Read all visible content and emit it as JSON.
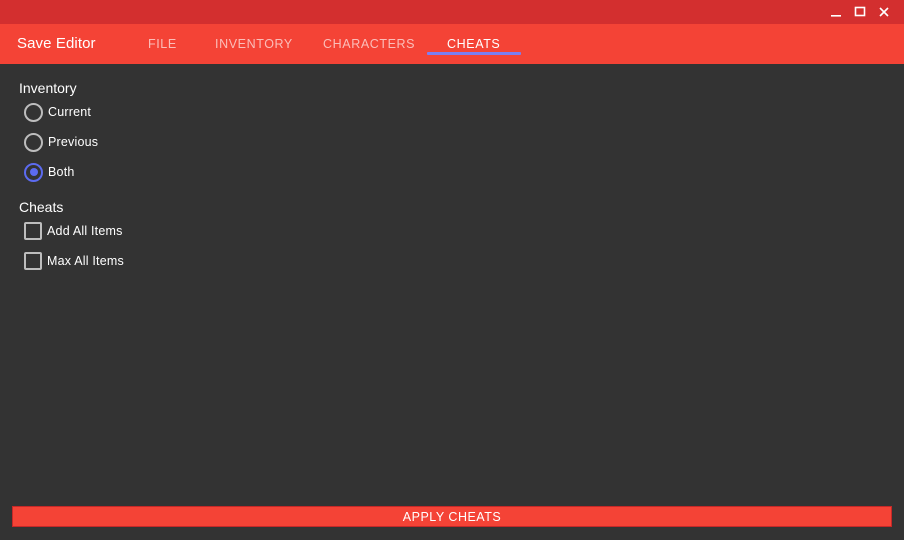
{
  "window": {
    "controls": {
      "minimize_icon": "minimize-icon",
      "maximize_icon": "maximize-icon",
      "close_icon": "close-icon"
    }
  },
  "appbar": {
    "title": "Save Editor",
    "tabs": [
      {
        "label": "FILE",
        "active": false
      },
      {
        "label": "INVENTORY",
        "active": false
      },
      {
        "label": "CHARACTERS",
        "active": false
      },
      {
        "label": "CHEATS",
        "active": true
      }
    ]
  },
  "inventory": {
    "heading": "Inventory",
    "options": [
      {
        "label": "Current",
        "selected": false
      },
      {
        "label": "Previous",
        "selected": false
      },
      {
        "label": "Both",
        "selected": true
      }
    ]
  },
  "cheats": {
    "heading": "Cheats",
    "options": [
      {
        "label": "Add All Items",
        "checked": false
      },
      {
        "label": "Max All Items",
        "checked": false
      }
    ]
  },
  "actions": {
    "apply_label": "APPLY CHEATS"
  },
  "colors": {
    "titlebar": "#d32f2f",
    "appbar": "#f44336",
    "background": "#333333",
    "accent": "#5c6bf0",
    "tab_indicator": "#7b7ff2"
  }
}
